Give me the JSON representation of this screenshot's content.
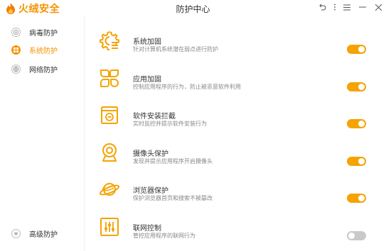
{
  "app": {
    "brand": "火绒安全",
    "window_title": "防护中心"
  },
  "sidebar": {
    "items": [
      {
        "label": "病毒防护",
        "icon": "target-icon",
        "active": false
      },
      {
        "label": "系统防护",
        "icon": "windows-icon",
        "active": true
      },
      {
        "label": "网络防护",
        "icon": "globe-icon",
        "active": false
      }
    ],
    "bottom_item": {
      "label": "高级防护",
      "icon": "advanced-icon"
    }
  },
  "features": [
    {
      "title": "系统加固",
      "desc": "针对计算机系统潜在弱点进行防护",
      "icon": "system-harden-icon",
      "enabled": true
    },
    {
      "title": "应用加固",
      "desc": "控制应用程序的行为，防止被恶意软件利用",
      "icon": "app-harden-icon",
      "enabled": true
    },
    {
      "title": "软件安装拦截",
      "desc": "实时监控并提示软件安装行为",
      "icon": "install-block-icon",
      "enabled": true
    },
    {
      "title": "摄像头保护",
      "desc": "发现并提示应用程序开启摄像头",
      "icon": "camera-icon",
      "enabled": true
    },
    {
      "title": "浏览器保护",
      "desc": "保护浏览器首页和搜索不被篡改",
      "icon": "browser-planet-icon",
      "enabled": true
    },
    {
      "title": "联网控制",
      "desc": "管控应用程序的联网行为",
      "icon": "network-control-icon",
      "enabled": false
    }
  ],
  "colors": {
    "accent": "#f5a300",
    "brand": "#f59300",
    "toggle_off": "#c9c9c9"
  }
}
